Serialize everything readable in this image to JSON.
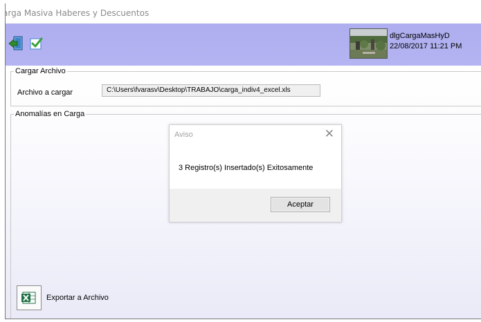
{
  "window": {
    "title": "arga Masiva Haberes y Descuentos"
  },
  "toolbar": {
    "buttons": [
      {
        "name": "exit-button",
        "icon": "exit-door-icon"
      },
      {
        "name": "confirm-button",
        "icon": "checkmark-icon"
      }
    ],
    "user_name": "dlgCargaMasHyD",
    "datetime": "22/08/2017 11:21 PM"
  },
  "cargar_archivo": {
    "legend": "Cargar Archivo",
    "file_label": "Archivo a cargar",
    "file_path": "C:\\Users\\fvarasv\\Desktop\\TRABAJO\\carga_indiv4_excel.xls"
  },
  "anomalias": {
    "legend": "Anomalías en Carga"
  },
  "dialog": {
    "title": "Aviso",
    "message": "3 Registro(s) Insertado(s) Exitosamente",
    "ok_label": "Aceptar"
  },
  "export": {
    "label": "Exportar a Archivo",
    "icon": "excel-icon"
  },
  "colors": {
    "toolbar_bg": "#b0b0f0",
    "body_gradient_end": "#eaeaf8",
    "dialog_footer": "#f0f0f0"
  }
}
